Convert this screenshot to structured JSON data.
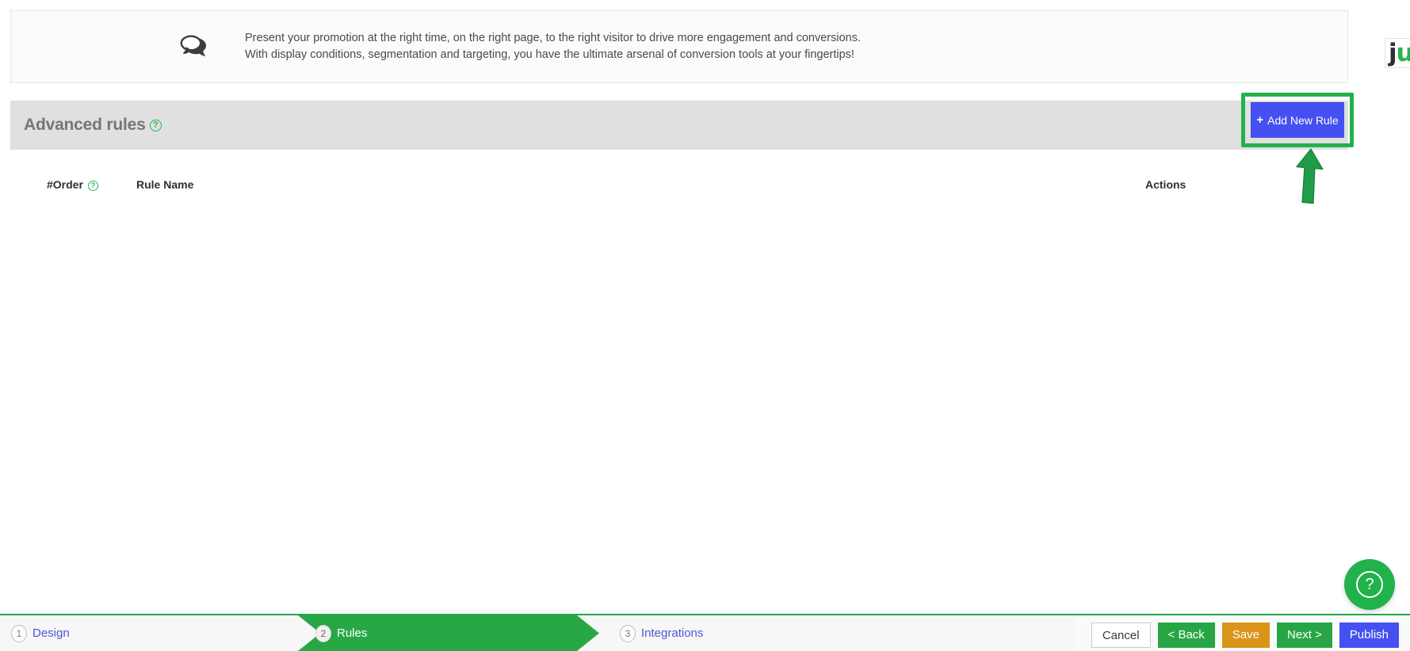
{
  "banner": {
    "icon": "speech-bubbles-icon",
    "line1": "Present your promotion at the right time, on the right page, to the right visitor to drive more engagement and conversions.",
    "line2": "With display conditions, segmentation and targeting, you have the ultimate arsenal of conversion tools at your fingertips!"
  },
  "brand": {
    "part1": "j",
    "part2": "u"
  },
  "section": {
    "title": "Advanced rules",
    "help_glyph": "?",
    "add_rule_label": "Add New Rule",
    "add_rule_plus": "+"
  },
  "table": {
    "columns": {
      "order": "#Order",
      "order_help_glyph": "?",
      "rule_name": "Rule Name",
      "actions": "Actions"
    },
    "rows": []
  },
  "fab": {
    "glyph": "?"
  },
  "footer": {
    "steps": [
      {
        "number": "1",
        "label": "Design",
        "active": false
      },
      {
        "number": "2",
        "label": "Rules",
        "active": true
      },
      {
        "number": "3",
        "label": "Integrations",
        "active": false
      }
    ],
    "buttons": {
      "cancel": "Cancel",
      "back": "< Back",
      "save": "Save",
      "next": "Next >",
      "publish": "Publish"
    }
  },
  "colors": {
    "accent_green": "#28a745",
    "highlight_green": "#22b14c",
    "primary_blue": "#4550f2",
    "save_orange": "#d9941a",
    "link_blue": "#4b57d8",
    "header_grey": "#e0e0e0"
  }
}
